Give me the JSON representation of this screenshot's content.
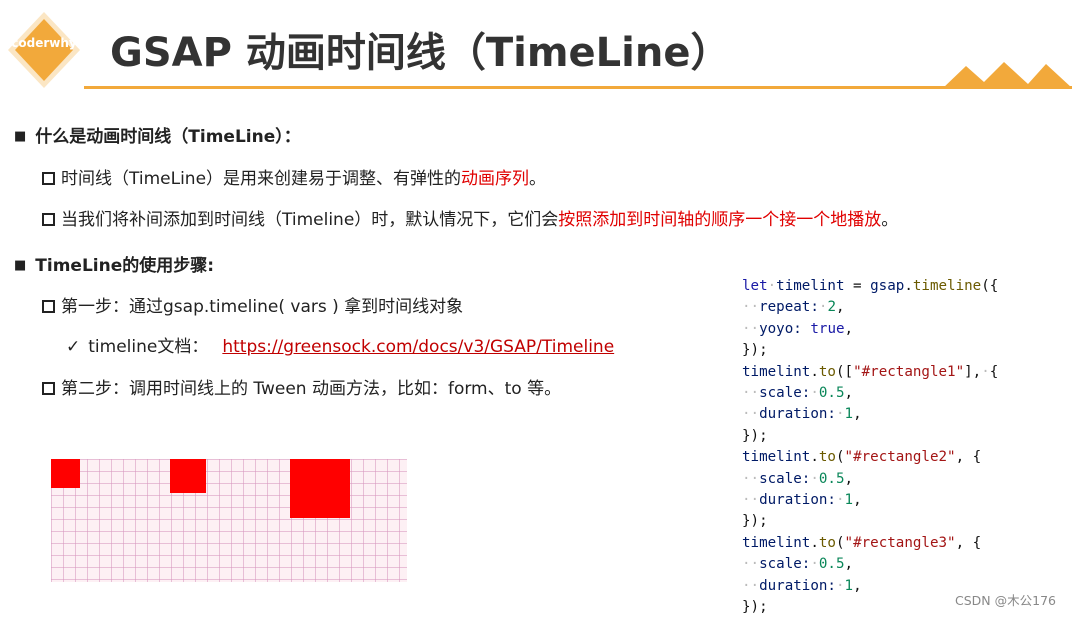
{
  "header": {
    "logo_text": "coderwhy",
    "title": "GSAP 动画时间线（TimeLine）"
  },
  "section1": {
    "heading": "什么是动画时间线（TimeLine）：",
    "item1": {
      "text": "时间线（TimeLine）是用来创建易于调整、有弹性的",
      "highlight": "动画序列",
      "tail": "。"
    },
    "item2": {
      "text": "当我们将补间添加到时间线（Timeline）时，默认情况下，它们会",
      "highlight": "按照添加到时间轴的顺序一个接一个地播放",
      "tail": "。"
    }
  },
  "section2": {
    "heading": "TimeLine的使用步骤:",
    "step1": "第一步：通过gsap.timeline( vars ) 拿到时间线对象",
    "doc_label": "timeline文档：",
    "doc_link": "https://greensock.com/docs/v3/GSAP/Timeline",
    "step2": "第二步：调用时间线上的 Tween 动画方法，比如：form、to 等。"
  },
  "code": {
    "var_name": "timelint",
    "call1": "gsap.timeline",
    "repeat_key": "repeat:",
    "repeat_val": "2",
    "yoyo_key": "yoyo:",
    "yoyo_val": "true",
    "to": "to",
    "target1": "\"#rectangle1\"",
    "target2": "\"#rectangle2\"",
    "target3": "\"#rectangle3\"",
    "scale_key": "scale:",
    "scale_val": "0.5",
    "duration_key": "duration:",
    "duration_val": "1"
  },
  "colors": {
    "accent": "#f2a93b",
    "highlight": "#e00000",
    "rect": "#ff0000"
  },
  "watermark": "CSDN @木公176"
}
